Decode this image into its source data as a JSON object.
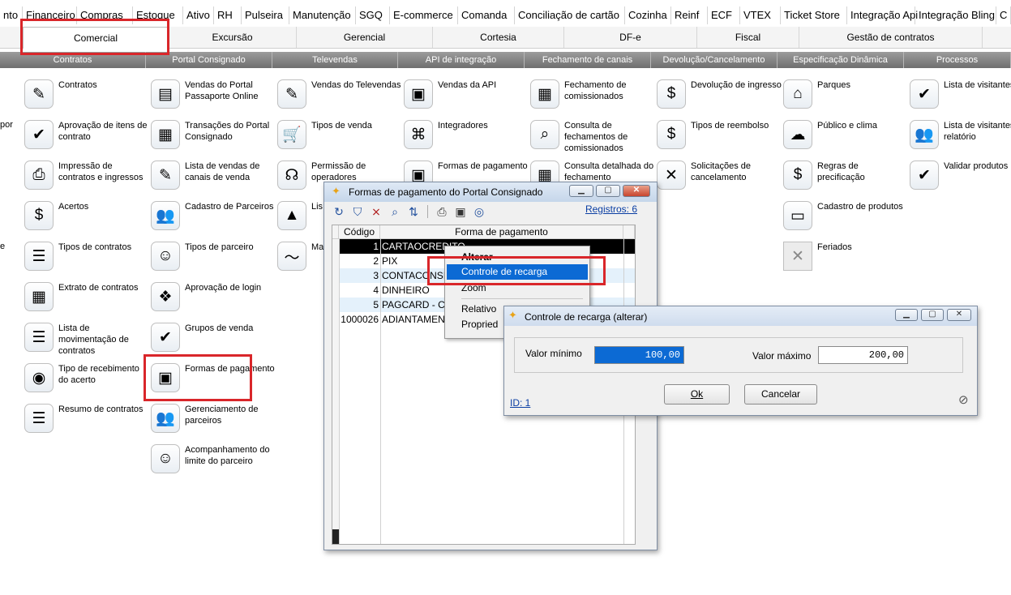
{
  "menubar": [
    "nto",
    "Financeiro",
    "Compras",
    "Estoque",
    "Ativo",
    "RH",
    "Pulseira",
    "Manutenção",
    "SGQ",
    "E-commerce",
    "Comanda",
    "Conciliação de cartão",
    "Cozinha",
    "Reinf",
    "ECF",
    "VTEX",
    "Ticket Store",
    "Integração Api",
    "Integração Bling",
    "C"
  ],
  "tabs": [
    "Comercial",
    "Excursão",
    "Gerencial",
    "Cortesia",
    "DF-e",
    "Fiscal",
    "Gestão de contratos"
  ],
  "categories": [
    "Contratos",
    "Portal Consignado",
    "Televendas",
    "API de integração",
    "Fechamento de canais",
    "Devolução/Cancelamento",
    "Especificação Dinâmica",
    "Processos"
  ],
  "left_fragments": [
    "por",
    "e"
  ],
  "col1": [
    {
      "label": "Contratos",
      "icon": "pen-document-icon"
    },
    {
      "label": "Aprovação de itens de contrato",
      "icon": "check-document-icon"
    },
    {
      "label": "Impressão de contratos e ingressos",
      "icon": "printer-icon"
    },
    {
      "label": "Acertos",
      "icon": "money-check-icon"
    },
    {
      "label": "Tipos de contratos",
      "icon": "list-icon"
    },
    {
      "label": "Extrato de contratos",
      "icon": "calculator-icon"
    },
    {
      "label": "Lista de movimentação de contratos",
      "icon": "list-icon"
    },
    {
      "label": "Tipo de recebimento do acerto",
      "icon": "coins-icon"
    },
    {
      "label": "Resumo de contratos",
      "icon": "list-refresh-icon"
    }
  ],
  "col2": [
    {
      "label": "Vendas do Portal Passaporte Online",
      "icon": "receipt-icon"
    },
    {
      "label": "Transações do Portal Consignado",
      "icon": "abacus-icon"
    },
    {
      "label": "Lista de vendas de canais de venda",
      "icon": "document-edit-icon"
    },
    {
      "label": "Cadastro de Parceiros",
      "icon": "people-icon"
    },
    {
      "label": "Tipos de parceiro",
      "icon": "person-document-icon"
    },
    {
      "label": "Aprovação de login",
      "icon": "check-cube-icon"
    },
    {
      "label": "Grupos de venda",
      "icon": "check-calendar-icon"
    },
    {
      "label": "Formas de pagamento",
      "icon": "payment-icon"
    },
    {
      "label": "Gerenciamento de parceiros",
      "icon": "people-icon"
    },
    {
      "label": "Acompanhamento do limite do parceiro",
      "icon": "person-money-icon"
    }
  ],
  "col3": [
    {
      "label": "Vendas do Televendas",
      "icon": "document-edit-icon"
    },
    {
      "label": "Tipos de venda",
      "icon": "cart-icon"
    },
    {
      "label": "Permissão de operadores",
      "icon": "headset-icon"
    },
    {
      "label": "Lis",
      "icon": "chart-icon"
    },
    {
      "label": "Ma",
      "icon": "line-chart-icon"
    }
  ],
  "col4": [
    {
      "label": "Vendas da API",
      "icon": "cash-register-icon"
    },
    {
      "label": "Integradores",
      "icon": "network-icon"
    },
    {
      "label": "Formas de pagamento",
      "icon": "payment-icon"
    }
  ],
  "col5": [
    {
      "label": "Fechamento de comissionados",
      "icon": "calendar-icon"
    },
    {
      "label": "Consulta de fechamentos de comissionados",
      "icon": "magnifier-icon"
    },
    {
      "label": "Consulta detalhada do fechamento",
      "icon": "calendar-icon"
    }
  ],
  "col6": [
    {
      "label": "Devolução de ingresso",
      "icon": "money-ok-icon"
    },
    {
      "label": "Tipos de reembolso",
      "icon": "money-bag-icon"
    },
    {
      "label": "Solicitações de cancelamento",
      "icon": "tools-cancel-icon"
    }
  ],
  "col7": [
    {
      "label": "Parques",
      "icon": "park-icon"
    },
    {
      "label": "Público e clima",
      "icon": "weather-icon"
    },
    {
      "label": "Regras de precificação",
      "icon": "pricing-icon"
    },
    {
      "label": "Cadastro de produtos",
      "icon": "tickets-icon"
    },
    {
      "label": "Feriados",
      "icon": "placeholder-icon"
    }
  ],
  "col8": [
    {
      "label": "Lista de visitantes",
      "icon": "clipboard-check-icon"
    },
    {
      "label": "Lista de visitantes relatório",
      "icon": "people-icon"
    },
    {
      "label": "Validar produtos",
      "icon": "check-document-icon"
    }
  ],
  "fp_window": {
    "title": "Formas de pagamento do Portal Consignado",
    "registros": "Registros: 6",
    "headers": [
      "Código",
      "Forma de pagamento"
    ],
    "rows": [
      {
        "code": "1",
        "name": "CARTAOCREDITO"
      },
      {
        "code": "2",
        "name": "PIX"
      },
      {
        "code": "3",
        "name": "CONTACONSI"
      },
      {
        "code": "4",
        "name": "DINHEIRO"
      },
      {
        "code": "5",
        "name": "PAGCARD - C"
      },
      {
        "code": "1000026",
        "name": "ADIANTAMENT"
      }
    ],
    "row_marker": "▸"
  },
  "context_menu": [
    "Alterar",
    "Controle de recarga",
    "Zoom",
    "Relativo",
    "Propried"
  ],
  "cr_dialog": {
    "title": "Controle de recarga (alterar)",
    "min_label": "Valor mínimo",
    "min_value": "100,00",
    "max_label": "Valor máximo",
    "max_value": "200,00",
    "id_text": "ID: 1",
    "ok": "Ok",
    "cancel": "Cancelar"
  },
  "colors": {
    "highlight": "#d9262a",
    "selection": "#0c6ad4",
    "link": "#0a3ea3"
  }
}
